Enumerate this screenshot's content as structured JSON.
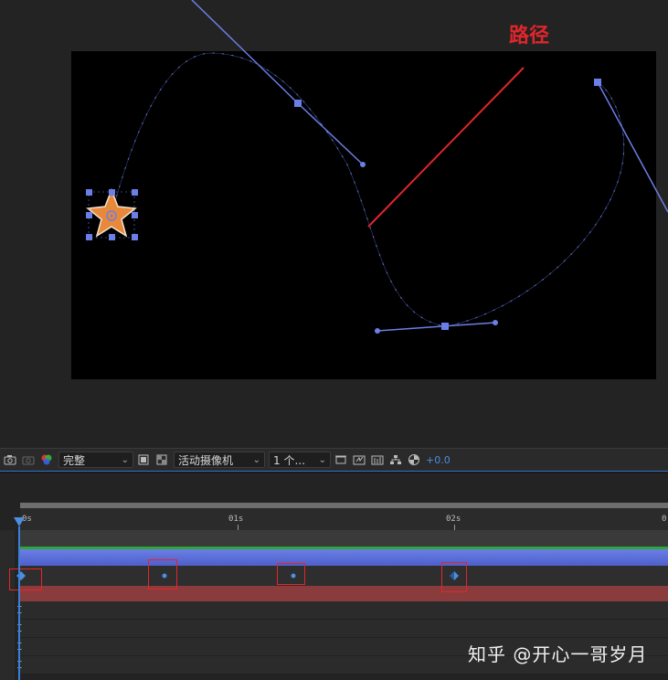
{
  "annotation": {
    "text": "路径",
    "color": "#e0262b"
  },
  "toolbar": {
    "quality": "完整",
    "camera": "活动摄像机",
    "views": "1 个...",
    "exposure": "+0.0",
    "icons": [
      "camera-icon",
      "show-snapshot-icon",
      "color-channel-icon",
      "region-of-interest-icon",
      "transparency-grid-icon",
      "fast-preview-icon",
      "timeline-icon",
      "flowchart-icon",
      "reset-exposure-icon"
    ]
  },
  "timeline": {
    "ticks": [
      "0s",
      "01s",
      "02s",
      "0"
    ],
    "accent": "#4a8fe0",
    "layer_color": "#5b6fd8",
    "keyframe_color": "#e8242a"
  },
  "watermark": "知乎 @开心一哥岁月"
}
